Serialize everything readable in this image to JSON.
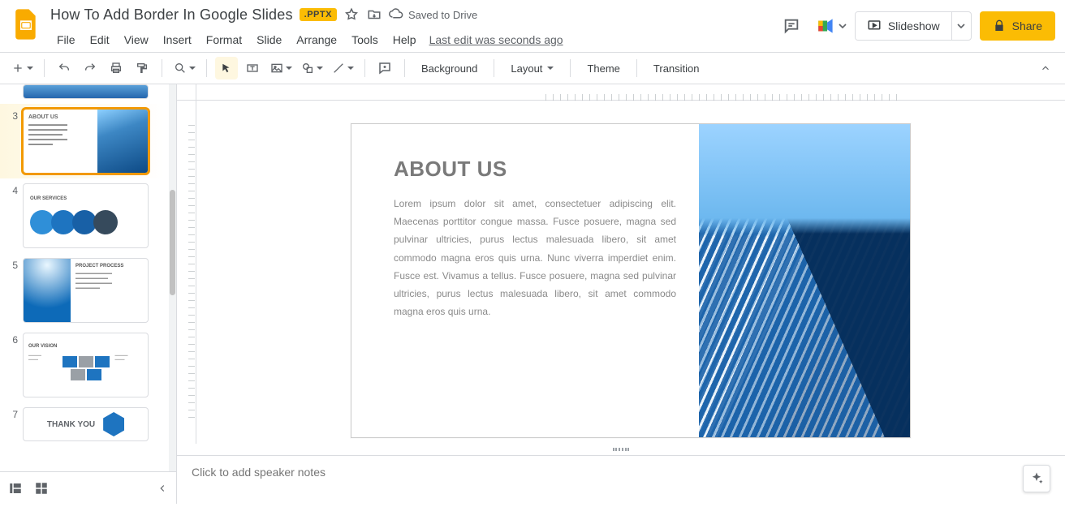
{
  "header": {
    "doc_title": "How To Add Border In Google Slides",
    "file_badge": ".PPTX",
    "saved_label": "Saved to Drive",
    "last_edit": "Last edit was seconds ago",
    "menus": [
      "File",
      "Edit",
      "View",
      "Insert",
      "Format",
      "Slide",
      "Arrange",
      "Tools",
      "Help"
    ],
    "slideshow_label": "Slideshow",
    "share_label": "Share"
  },
  "toolbar": {
    "background": "Background",
    "layout": "Layout",
    "theme": "Theme",
    "transition": "Transition"
  },
  "thumbnails": [
    {
      "n": "",
      "title": ""
    },
    {
      "n": "3",
      "title": "ABOUT US",
      "selected": true
    },
    {
      "n": "4",
      "title": "OUR SERVICES"
    },
    {
      "n": "5",
      "title": "PROJECT PROCESS"
    },
    {
      "n": "6",
      "title": "OUR VISION"
    },
    {
      "n": "7",
      "title": "THANK YOU"
    }
  ],
  "slide": {
    "heading": "ABOUT US",
    "body": "Lorem ipsum dolor sit amet, consectetuer adipiscing elit. Maecenas porttitor congue massa. Fusce posuere, magna sed pulvinar ultricies, purus lectus malesuada libero, sit amet commodo magna eros quis urna. Nunc viverra imperdiet enim. Fusce est. Vivamus a tellus. Fusce posuere, magna sed pulvinar ultricies, purus lectus malesuada libero, sit amet commodo magna eros quis urna."
  },
  "notes_placeholder": "Click to add speaker notes"
}
